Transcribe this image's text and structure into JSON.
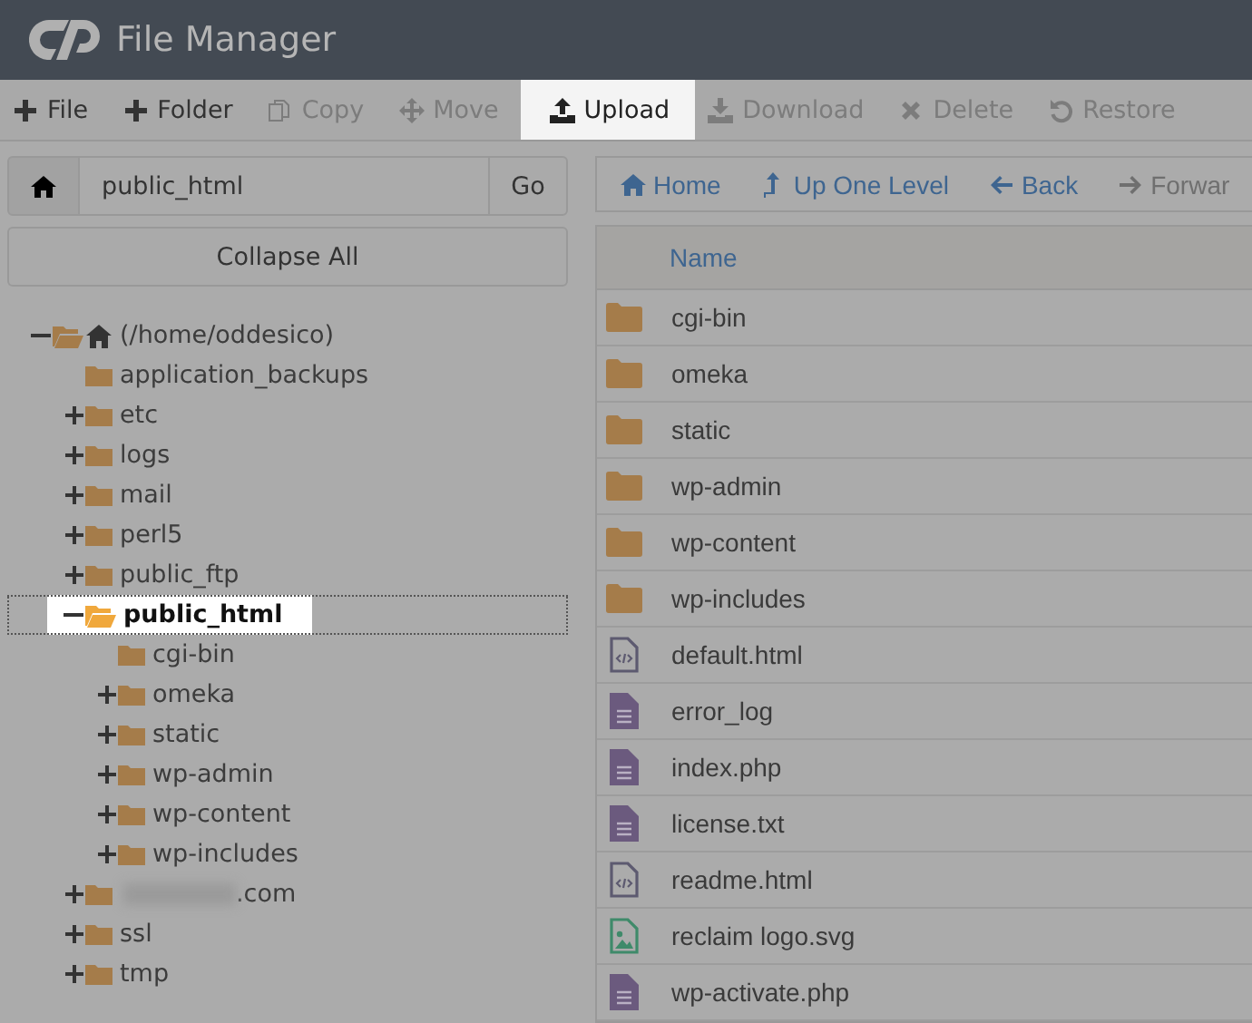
{
  "header": {
    "title": "File Manager"
  },
  "toolbar": [
    {
      "label": "File",
      "kind": "plus",
      "disabled": false,
      "selected": false
    },
    {
      "label": "Folder",
      "kind": "plus",
      "disabled": false,
      "selected": false
    },
    {
      "label": "Copy",
      "kind": "copy",
      "disabled": true,
      "selected": false
    },
    {
      "label": "Move",
      "kind": "move",
      "disabled": true,
      "selected": false
    },
    {
      "label": "Upload",
      "kind": "upload",
      "disabled": false,
      "selected": true
    },
    {
      "label": "Download",
      "kind": "download",
      "disabled": true,
      "selected": false
    },
    {
      "label": "Delete",
      "kind": "delete",
      "disabled": true,
      "selected": false
    },
    {
      "label": "Restore",
      "kind": "restore",
      "disabled": true,
      "selected": false
    }
  ],
  "path_field": {
    "value": "public_html",
    "go": "Go"
  },
  "collapse_button": "Collapse All",
  "tree": [
    {
      "label": "(/home/oddesico)",
      "kind": "root",
      "expanded": true,
      "selected": false,
      "children": [
        {
          "label": "application_backups",
          "kind": "leaf",
          "selected": false
        },
        {
          "label": "etc",
          "kind": "folder",
          "expanded": false,
          "selected": false
        },
        {
          "label": "logs",
          "kind": "folder",
          "expanded": false,
          "selected": false
        },
        {
          "label": "mail",
          "kind": "folder",
          "expanded": false,
          "selected": false
        },
        {
          "label": "perl5",
          "kind": "folder",
          "expanded": false,
          "selected": false
        },
        {
          "label": "public_ftp",
          "kind": "folder",
          "expanded": false,
          "selected": false
        },
        {
          "label": "public_html",
          "kind": "folder",
          "expanded": true,
          "selected": true,
          "children": [
            {
              "label": "cgi-bin",
              "kind": "leaf",
              "selected": false
            },
            {
              "label": "omeka",
              "kind": "folder",
              "expanded": false,
              "selected": false
            },
            {
              "label": "static",
              "kind": "folder",
              "expanded": false,
              "selected": false
            },
            {
              "label": "wp-admin",
              "kind": "folder",
              "expanded": false,
              "selected": false
            },
            {
              "label": "wp-content",
              "kind": "folder",
              "expanded": false,
              "selected": false
            },
            {
              "label": "wp-includes",
              "kind": "folder",
              "expanded": false,
              "selected": false
            }
          ]
        },
        {
          "label": ".com",
          "kind": "blurred",
          "expanded": false,
          "selected": false
        },
        {
          "label": "ssl",
          "kind": "folder",
          "expanded": false,
          "selected": false
        },
        {
          "label": "tmp",
          "kind": "folder",
          "expanded": false,
          "selected": false
        }
      ]
    }
  ],
  "nav": [
    {
      "label": "Home",
      "kind": "home",
      "disabled": false
    },
    {
      "label": "Up One Level",
      "kind": "up",
      "disabled": false
    },
    {
      "label": "Back",
      "kind": "back",
      "disabled": false
    },
    {
      "label": "Forwar",
      "kind": "forward",
      "disabled": true
    }
  ],
  "table": {
    "columns": [
      "Name"
    ],
    "rows": [
      {
        "name": "cgi-bin",
        "kind": "folder"
      },
      {
        "name": "omeka",
        "kind": "folder"
      },
      {
        "name": "static",
        "kind": "folder"
      },
      {
        "name": "wp-admin",
        "kind": "folder"
      },
      {
        "name": "wp-content",
        "kind": "folder"
      },
      {
        "name": "wp-includes",
        "kind": "folder"
      },
      {
        "name": "default.html",
        "kind": "html"
      },
      {
        "name": "error_log",
        "kind": "text"
      },
      {
        "name": "index.php",
        "kind": "text"
      },
      {
        "name": "license.txt",
        "kind": "text"
      },
      {
        "name": "readme.html",
        "kind": "html"
      },
      {
        "name": "reclaim logo.svg",
        "kind": "image"
      },
      {
        "name": "wp-activate.php",
        "kind": "text"
      }
    ]
  }
}
